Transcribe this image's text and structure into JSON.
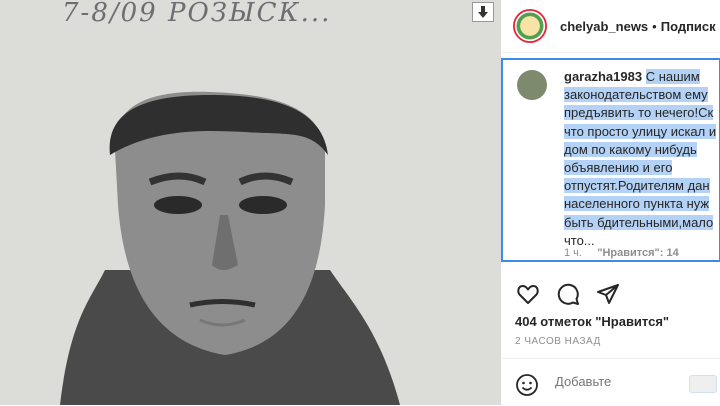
{
  "photo": {
    "caption": "7-8/09 РОЗЫСК..."
  },
  "header": {
    "username": "chelyab_news",
    "follow_label": "Подписк"
  },
  "comment": {
    "user": "garazha1983",
    "text_lines": [
      "С нашим",
      "законодательством ему",
      "предъявить то нечего!Ск",
      "что просто улицу искал и",
      "дом по какому нибудь",
      "объявлению и его",
      "отпустят.Родителям дан",
      "населенного пункта нуж",
      "быть бдительными,мало",
      "что..."
    ],
    "time": "1 ч.",
    "likes_label": "\"Нравится\": 14"
  },
  "post": {
    "likes": "404 отметок \"Нравится\"",
    "time": "2 ЧАСОВ НАЗАД"
  },
  "add_comment": {
    "placeholder": "Добавьте"
  },
  "colors": {
    "selection": "#b3d2f5",
    "focus_border": "#3b8de6"
  }
}
